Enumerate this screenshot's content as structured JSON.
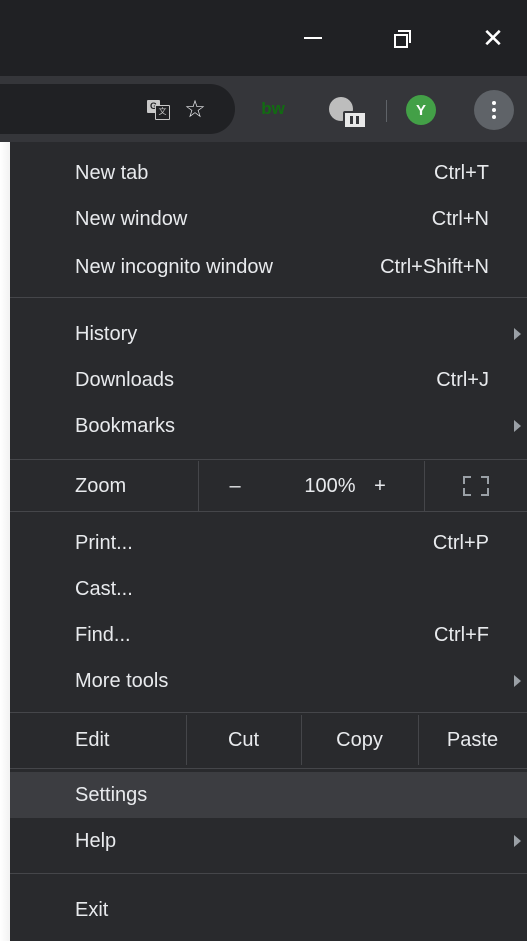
{
  "window": {
    "minimize_icon": "minimize-icon",
    "restore_icon": "restore-icon",
    "close_glyph": "✕"
  },
  "toolbar": {
    "translate_glyph_a": "G",
    "translate_glyph_b": "文",
    "star_glyph": "☆",
    "bw_label": "bw",
    "avatar_letter": "Y"
  },
  "menu": {
    "group1": [
      {
        "label": "New tab",
        "shortcut": "Ctrl+T"
      },
      {
        "label": "New window",
        "shortcut": "Ctrl+N"
      },
      {
        "label": "New incognito window",
        "shortcut": "Ctrl+Shift+N"
      }
    ],
    "group2": [
      {
        "label": "History",
        "shortcut": ""
      },
      {
        "label": "Downloads",
        "shortcut": "Ctrl+J"
      },
      {
        "label": "Bookmarks",
        "shortcut": ""
      }
    ],
    "zoom": {
      "label": "Zoom",
      "minus": "–",
      "value": "100%",
      "plus": "+"
    },
    "group3": [
      {
        "label": "Print...",
        "shortcut": "Ctrl+P"
      },
      {
        "label": "Cast...",
        "shortcut": ""
      },
      {
        "label": "Find...",
        "shortcut": "Ctrl+F"
      },
      {
        "label": "More tools",
        "shortcut": ""
      }
    ],
    "edit": {
      "label": "Edit",
      "cut": "Cut",
      "copy": "Copy",
      "paste": "Paste"
    },
    "group4": [
      {
        "label": "Settings"
      },
      {
        "label": "Help"
      }
    ],
    "exit": "Exit"
  },
  "colors": {
    "menu_bg": "#292a2d",
    "highlight": "#3c3d41",
    "avatar": "#43a047",
    "bw_green": "#126b12"
  }
}
